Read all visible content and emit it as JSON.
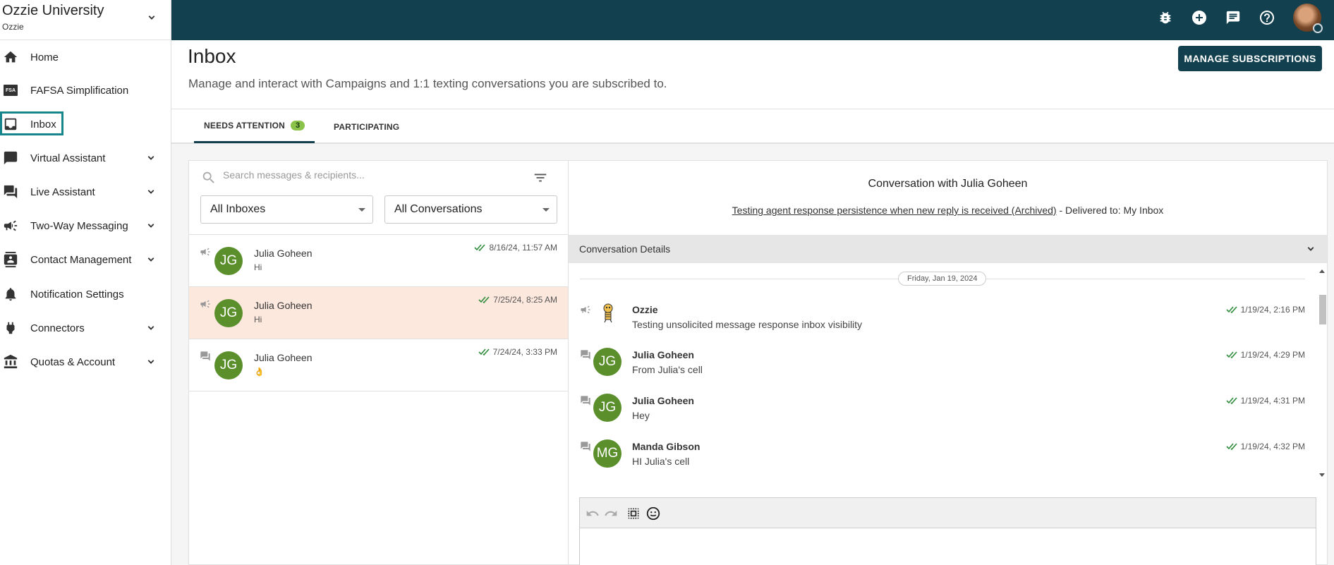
{
  "org": {
    "name": "Ozzie University",
    "sub": "Ozzie"
  },
  "sidebar": {
    "items": [
      {
        "label": "Home"
      },
      {
        "label": "FAFSA Simplification",
        "badge": "FSA"
      },
      {
        "label": "Inbox",
        "active": true
      },
      {
        "label": "Virtual Assistant"
      },
      {
        "label": "Live Assistant"
      },
      {
        "label": "Two-Way Messaging"
      },
      {
        "label": "Contact Management"
      },
      {
        "label": "Notification Settings"
      },
      {
        "label": "Connectors"
      },
      {
        "label": "Quotas & Account"
      }
    ]
  },
  "page": {
    "title": "Inbox",
    "subtitle": "Manage and interact with Campaigns and 1:1 texting conversations you are subscribed to.",
    "manage_button": "MANAGE SUBSCRIPTIONS"
  },
  "tabs": [
    {
      "label": "NEEDS ATTENTION",
      "count": "3"
    },
    {
      "label": "PARTICIPATING"
    }
  ],
  "search": {
    "placeholder": "Search messages & recipients..."
  },
  "filters": {
    "inbox": "All Inboxes",
    "conversations": "All Conversations"
  },
  "conversations": [
    {
      "initials": "JG",
      "name": "Julia Goheen",
      "preview": "Hi",
      "time": "8/16/24, 11:57 AM"
    },
    {
      "initials": "JG",
      "name": "Julia Goheen",
      "preview": "Hi",
      "time": "7/25/24, 8:25 AM"
    },
    {
      "initials": "JG",
      "name": "Julia Goheen",
      "preview": "👌",
      "time": "7/24/24, 3:33 PM"
    }
  ],
  "detail": {
    "title": "Conversation with Julia Goheen",
    "campaign_link": "Testing agent response persistence when new reply is received (Archived)",
    "delivered": " - Delivered to: My Inbox",
    "details_label": "Conversation Details",
    "date_chip": "Friday, Jan 19, 2024",
    "messages": [
      {
        "name": "Ozzie",
        "text": "Testing unsolicited message response inbox visibility",
        "time": "1/19/24, 2:16 PM"
      },
      {
        "initials": "JG",
        "name": "Julia Goheen",
        "text": "From Julia's cell",
        "time": "1/19/24, 4:29 PM"
      },
      {
        "initials": "JG",
        "name": "Julia Goheen",
        "text": "Hey",
        "time": "1/19/24, 4:31 PM"
      },
      {
        "initials": "MG",
        "name": "Manda Gibson",
        "text": "HI Julia's cell",
        "time": "1/19/24, 4:32 PM"
      }
    ]
  },
  "colors": {
    "topbar": "#12404e",
    "avatar": "#5a8f2c",
    "selected_row": "#fde8de",
    "badge": "#8bc34a",
    "active_outline": "#16858c",
    "check": "#2e8b3a"
  }
}
